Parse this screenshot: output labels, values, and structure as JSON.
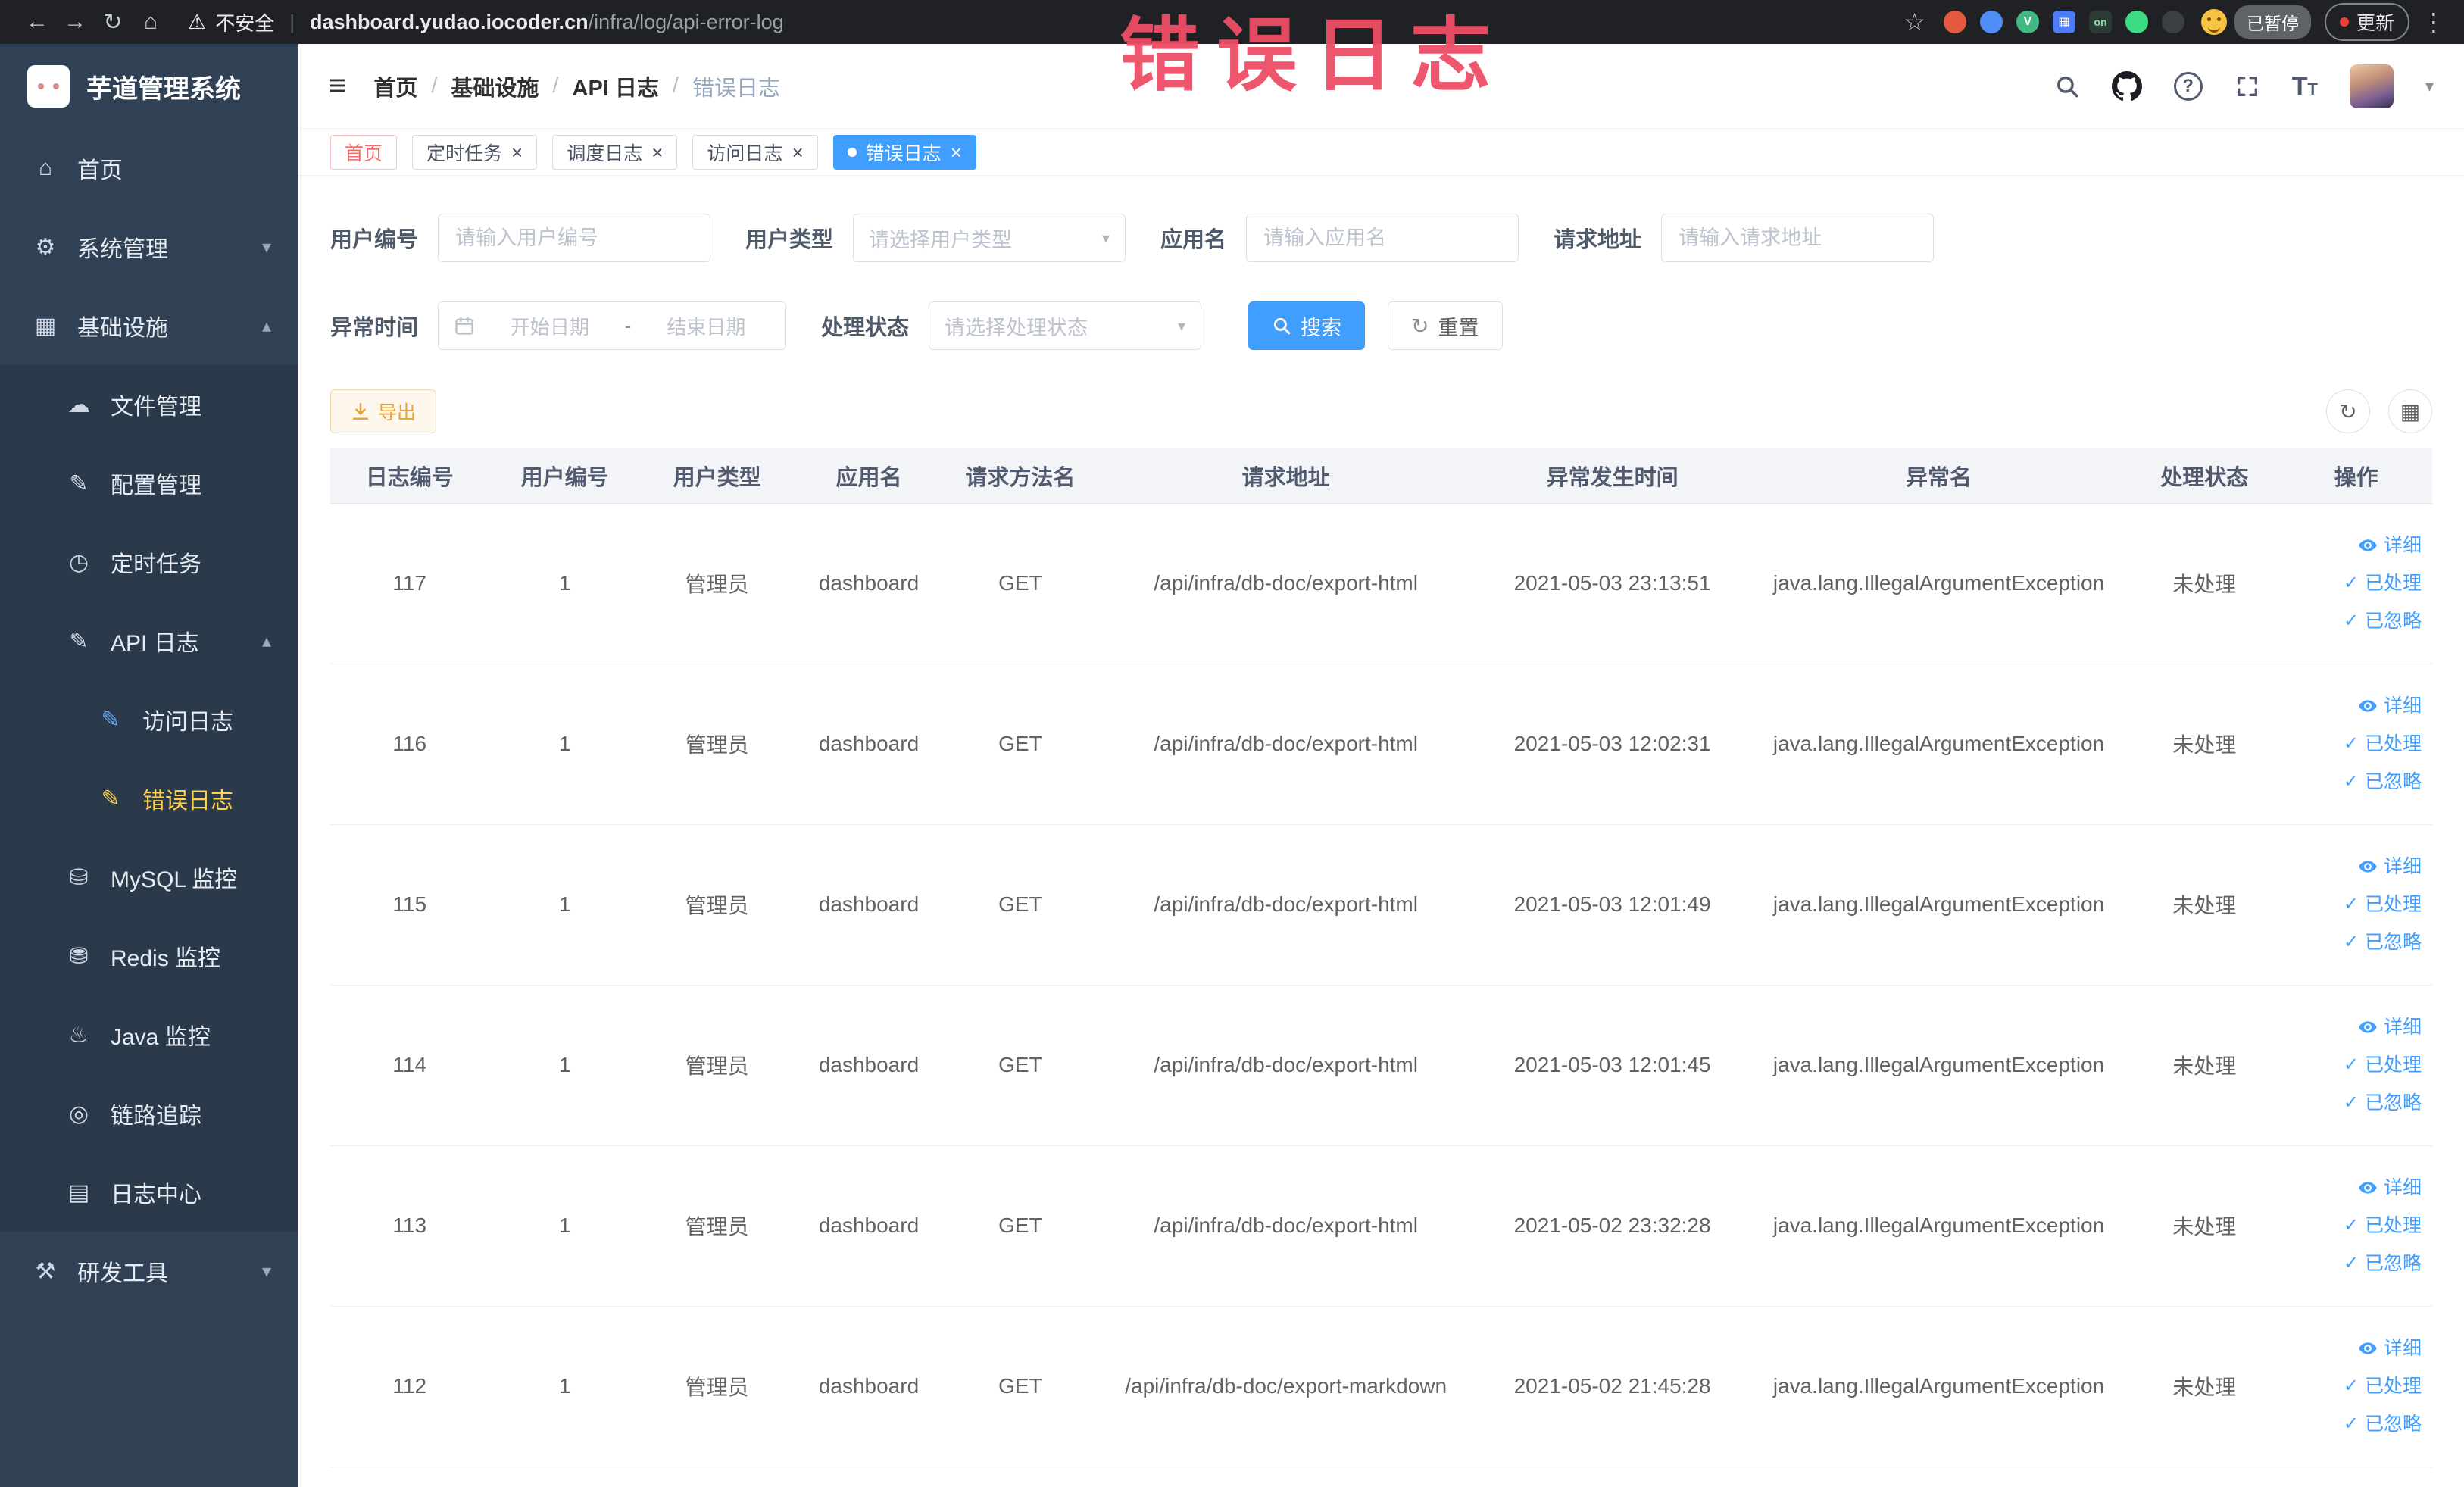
{
  "colors": {
    "primary": "#409eff",
    "warning": "#e6a23c",
    "sidebar_bg": "#304156",
    "sidebar_active_text": "#ffd04b",
    "table_header_bg": "#f2f4f8",
    "chrome_bg": "#1f2124",
    "annotation": "#ee4e66"
  },
  "browser": {
    "security_text": "不安全",
    "url_host": "dashboard.yudao.iocoder.cn",
    "url_path": "/infra/log/api-error-log",
    "paused_label": "已暂停",
    "update_label": "更新",
    "extensions": [
      {
        "name": "ext-red-icon",
        "color": "#e4593f"
      },
      {
        "name": "ext-blue-icon",
        "color": "#4f8ef7"
      },
      {
        "name": "ext-vue-icon",
        "color": "#42b883",
        "glyph": "V"
      },
      {
        "name": "ext-grid-icon",
        "color": "#4e7cf6",
        "glyph": "▦",
        "shape": "square"
      },
      {
        "name": "ext-on-icon",
        "color": "#2c3a36",
        "glyph": "on",
        "glyph_color": "#7ee3a0",
        "shape": "square"
      },
      {
        "name": "ext-green-icon",
        "color": "#3ddc84"
      },
      {
        "name": "ext-paw-icon",
        "color": "#3a3f44"
      }
    ]
  },
  "sidebar": {
    "title": "芋道管理系统",
    "items": [
      {
        "key": "home",
        "label": "首页",
        "icon": "dashboard-icon",
        "level": 0
      },
      {
        "key": "system",
        "label": "系统管理",
        "icon": "gear-icon",
        "level": 0,
        "arrow": "down"
      },
      {
        "key": "infra",
        "label": "基础设施",
        "icon": "infra-icon",
        "level": 0,
        "arrow": "up"
      },
      {
        "key": "file",
        "label": "文件管理",
        "icon": "cloud-icon",
        "level": 1
      },
      {
        "key": "config",
        "label": "配置管理",
        "icon": "edit-icon",
        "level": 1
      },
      {
        "key": "job",
        "label": "定时任务",
        "icon": "clock-icon",
        "level": 1
      },
      {
        "key": "api-log",
        "label": "API 日志",
        "icon": "api-log-icon",
        "level": 1,
        "arrow": "up"
      },
      {
        "key": "access-log",
        "label": "访问日志",
        "icon": "access-log-icon",
        "level": 2
      },
      {
        "key": "error-log",
        "label": "错误日志",
        "icon": "error-log-icon",
        "level": 2,
        "active": true
      },
      {
        "key": "mysql",
        "label": "MySQL 监控",
        "icon": "database-icon",
        "level": 1
      },
      {
        "key": "redis",
        "label": "Redis 监控",
        "icon": "redis-icon",
        "level": 1
      },
      {
        "key": "java",
        "label": "Java 监控",
        "icon": "java-icon",
        "level": 1
      },
      {
        "key": "trace",
        "label": "链路追踪",
        "icon": "trace-icon",
        "level": 1
      },
      {
        "key": "log-center",
        "label": "日志中心",
        "icon": "log-center-icon",
        "level": 1
      },
      {
        "key": "dev-tools",
        "label": "研发工具",
        "icon": "tools-icon",
        "level": 0,
        "arrow": "down"
      }
    ]
  },
  "header": {
    "breadcrumb": [
      "首页",
      "基础设施",
      "API 日志",
      "错误日志"
    ]
  },
  "annotation": {
    "text": "错误日志",
    "color": "#ee4e66"
  },
  "tags": [
    {
      "key": "home",
      "label": "首页",
      "affix": true,
      "closable": false
    },
    {
      "key": "job",
      "label": "定时任务",
      "closable": true
    },
    {
      "key": "job-log",
      "label": "调度日志",
      "closable": true
    },
    {
      "key": "access-log",
      "label": "访问日志",
      "closable": true
    },
    {
      "key": "error-log",
      "label": "错误日志",
      "closable": true,
      "active": true
    }
  ],
  "filters": {
    "user_id": {
      "label": "用户编号",
      "placeholder": "请输入用户编号"
    },
    "user_type": {
      "label": "用户类型",
      "placeholder": "请选择用户类型"
    },
    "app_name": {
      "label": "应用名",
      "placeholder": "请输入应用名"
    },
    "request_url": {
      "label": "请求地址",
      "placeholder": "请输入请求地址"
    },
    "exception_time": {
      "label": "异常时间",
      "start_placeholder": "开始日期",
      "separator": "-",
      "end_placeholder": "结束日期"
    },
    "process_status": {
      "label": "处理状态",
      "placeholder": "请选择处理状态"
    },
    "search_label": "搜索",
    "reset_label": "重置"
  },
  "toolbar": {
    "export_label": "导出"
  },
  "table": {
    "columns": [
      "日志编号",
      "用户编号",
      "用户类型",
      "应用名",
      "请求方法名",
      "请求地址",
      "异常发生时间",
      "异常名",
      "处理状态",
      "操作"
    ],
    "actions": [
      "详细",
      "已处理",
      "已忽略"
    ],
    "rows": [
      {
        "id": "117",
        "user_id": "1",
        "user_type": "管理员",
        "app": "dashboard",
        "method": "GET",
        "url": "/api/infra/db-doc/export-html",
        "time": "2021-05-03 23:13:51",
        "exception": "java.lang.IllegalArgumentException",
        "status": "未处理"
      },
      {
        "id": "116",
        "user_id": "1",
        "user_type": "管理员",
        "app": "dashboard",
        "method": "GET",
        "url": "/api/infra/db-doc/export-html",
        "time": "2021-05-03 12:02:31",
        "exception": "java.lang.IllegalArgumentException",
        "status": "未处理"
      },
      {
        "id": "115",
        "user_id": "1",
        "user_type": "管理员",
        "app": "dashboard",
        "method": "GET",
        "url": "/api/infra/db-doc/export-html",
        "time": "2021-05-03 12:01:49",
        "exception": "java.lang.IllegalArgumentException",
        "status": "未处理"
      },
      {
        "id": "114",
        "user_id": "1",
        "user_type": "管理员",
        "app": "dashboard",
        "method": "GET",
        "url": "/api/infra/db-doc/export-html",
        "time": "2021-05-03 12:01:45",
        "exception": "java.lang.IllegalArgumentException",
        "status": "未处理"
      },
      {
        "id": "113",
        "user_id": "1",
        "user_type": "管理员",
        "app": "dashboard",
        "method": "GET",
        "url": "/api/infra/db-doc/export-html",
        "time": "2021-05-02 23:32:28",
        "exception": "java.lang.IllegalArgumentException",
        "status": "未处理"
      },
      {
        "id": "112",
        "user_id": "1",
        "user_type": "管理员",
        "app": "dashboard",
        "method": "GET",
        "url": "/api/infra/db-doc/export-markdown",
        "time": "2021-05-02 21:45:28",
        "exception": "java.lang.IllegalArgumentException",
        "status": "未处理"
      }
    ]
  }
}
